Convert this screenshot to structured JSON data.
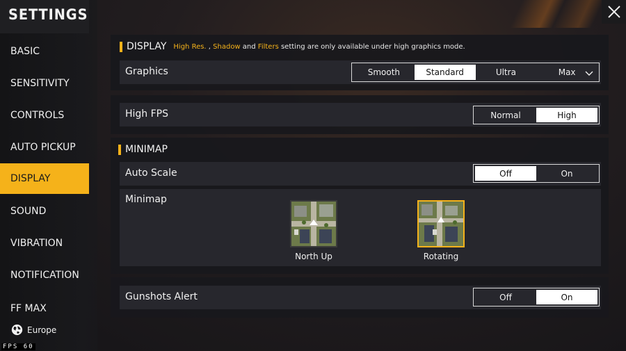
{
  "header": {
    "title": "SETTINGS"
  },
  "sidebar": {
    "items": [
      {
        "label": "BASIC"
      },
      {
        "label": "SENSITIVITY"
      },
      {
        "label": "CONTROLS"
      },
      {
        "label": "AUTO PICKUP"
      },
      {
        "label": "DISPLAY",
        "active": true
      },
      {
        "label": "SOUND"
      },
      {
        "label": "VIBRATION"
      },
      {
        "label": "NOTIFICATION"
      },
      {
        "label": "FF MAX"
      }
    ],
    "region": "Europe"
  },
  "fps_counter": {
    "label": "FPS",
    "value": "60"
  },
  "display_section": {
    "title": "DISPLAY",
    "note_parts": [
      "High Res.",
      " , ",
      "Shadow",
      " and ",
      "Filters",
      " setting are only available under high graphics mode."
    ]
  },
  "graphics": {
    "label": "Graphics",
    "options": [
      "Smooth",
      "Standard",
      "Ultra",
      "Max"
    ],
    "selected": "Standard"
  },
  "high_fps": {
    "label": "High FPS",
    "options": [
      "Normal",
      "High"
    ],
    "selected": "High"
  },
  "minimap_section": {
    "title": "MINIMAP"
  },
  "auto_scale": {
    "label": "Auto Scale",
    "options": [
      "Off",
      "On"
    ],
    "selected": "Off"
  },
  "minimap": {
    "label": "Minimap",
    "options": [
      "North Up",
      "Rotating"
    ],
    "selected": "Rotating"
  },
  "gunshots_alert": {
    "label": "Gunshots Alert",
    "options": [
      "Off",
      "On"
    ],
    "selected": "On"
  },
  "colors": {
    "accent": "#f5b21a",
    "panel": "#18181c",
    "row": "#28282e"
  },
  "icons": {
    "close": "close-x-icon",
    "region": "globe-icon",
    "dropdown": "chevron-down-icon"
  }
}
